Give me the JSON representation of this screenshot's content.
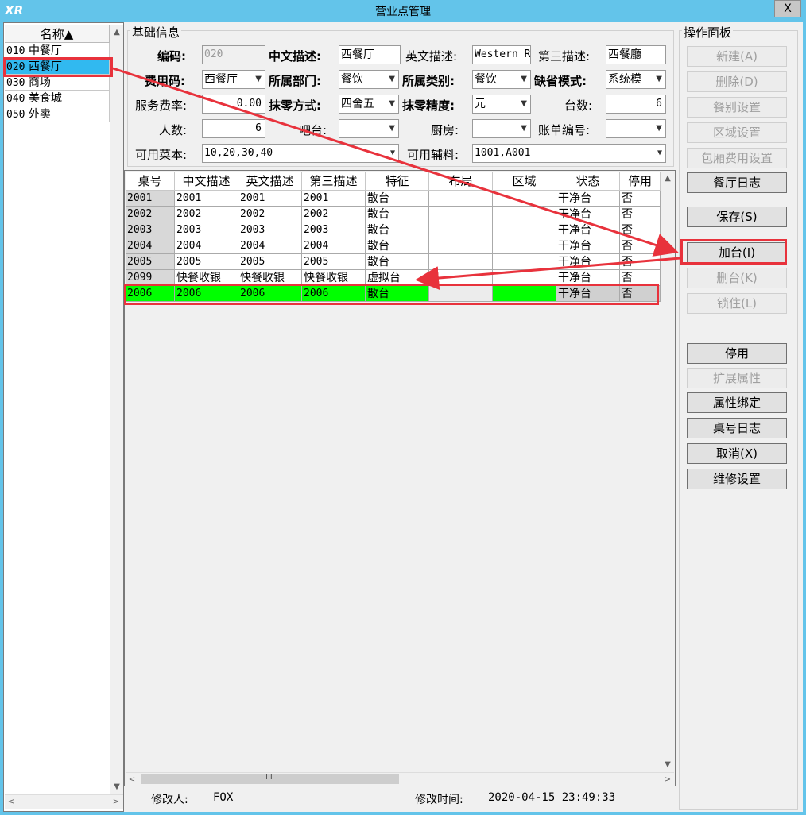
{
  "window": {
    "title": "营业点管理",
    "icon": "XR",
    "close_glyph": "X"
  },
  "left_list": {
    "header": "名称▲",
    "items": [
      {
        "code": "010",
        "name": "中餐厅"
      },
      {
        "code": "020",
        "name": "西餐厅"
      },
      {
        "code": "030",
        "name": "商场"
      },
      {
        "code": "040",
        "name": "美食城"
      },
      {
        "code": "050",
        "name": "外卖"
      }
    ],
    "selected_index": 1
  },
  "basic_info": {
    "legend": "基础信息",
    "code_label": "编码:",
    "code_value": "020",
    "cn_desc_label": "中文描述:",
    "cn_desc_value": "西餐厅",
    "en_desc_label": "英文描述:",
    "en_desc_value": "Western R",
    "third_desc_label": "第三描述:",
    "third_desc_value": "西餐廳",
    "fee_code_label": "费用码:",
    "fee_code_value": "西餐厅",
    "dept_label": "所属部门:",
    "dept_value": "餐饮",
    "category_label": "所属类别:",
    "category_value": "餐饮",
    "default_mode_label": "缺省模式:",
    "default_mode_value": "系统模",
    "service_rate_label": "服务费率:",
    "service_rate_value": "0.00",
    "rounding_method_label": "抹零方式:",
    "rounding_method_value": "四舍五",
    "rounding_precision_label": "抹零精度:",
    "rounding_precision_value": "元",
    "table_count_label": "台数:",
    "table_count_value": "6",
    "people_label": "人数:",
    "people_value": "6",
    "bar_label": "吧台:",
    "bar_value": "",
    "kitchen_label": "厨房:",
    "kitchen_value": "",
    "bill_no_label": "账单编号:",
    "bill_no_value": "",
    "menus_label": "可用菜本:",
    "menus_value": "10,20,30,40",
    "aux_label": "可用辅料:",
    "aux_value": "1001,A001"
  },
  "grid": {
    "columns": [
      "桌号",
      "中文描述",
      "英文描述",
      "第三描述",
      "特征",
      "布局",
      "区域",
      "状态",
      "停用"
    ],
    "rows": [
      [
        "2001",
        "2001",
        "2001",
        "2001",
        "散台",
        "",
        "",
        "干净台",
        "否"
      ],
      [
        "2002",
        "2002",
        "2002",
        "2002",
        "散台",
        "",
        "",
        "干净台",
        "否"
      ],
      [
        "2003",
        "2003",
        "2003",
        "2003",
        "散台",
        "",
        "",
        "干净台",
        "否"
      ],
      [
        "2004",
        "2004",
        "2004",
        "2004",
        "散台",
        "",
        "",
        "干净台",
        "否"
      ],
      [
        "2005",
        "2005",
        "2005",
        "2005",
        "散台",
        "",
        "",
        "干净台",
        "否"
      ],
      [
        "2099",
        "快餐收银",
        "快餐收银",
        "快餐收银",
        "虚拟台",
        "",
        "",
        "干净台",
        "否"
      ],
      [
        "2006",
        "2006",
        "2006",
        "2006",
        "散台",
        "",
        "",
        "干净台",
        "否"
      ]
    ],
    "highlight_row": 6,
    "scroll_grip": "III"
  },
  "footer": {
    "modifier_label": "修改人:",
    "modifier_value": "FOX",
    "time_label": "修改时间:",
    "time_value": "2020-04-15 23:49:33"
  },
  "ops": {
    "legend": "操作面板",
    "buttons": [
      {
        "key": "new",
        "label": "新建(A)",
        "enabled": false
      },
      {
        "key": "delete",
        "label": "删除(D)",
        "enabled": false
      },
      {
        "key": "meal-setting",
        "label": "餐别设置",
        "enabled": false
      },
      {
        "key": "area-setting",
        "label": "区域设置",
        "enabled": false
      },
      {
        "key": "room-fee-setting",
        "label": "包厢费用设置",
        "enabled": false
      },
      {
        "key": "restaurant-log",
        "label": "餐厅日志",
        "enabled": true
      },
      {
        "key": "save",
        "label": "保存(S)",
        "enabled": true
      },
      {
        "key": "add-table",
        "label": "加台(I)",
        "enabled": true
      },
      {
        "key": "delete-table",
        "label": "删台(K)",
        "enabled": false
      },
      {
        "key": "lock",
        "label": "锁住(L)",
        "enabled": false
      },
      {
        "key": "disable",
        "label": "停用",
        "enabled": true
      },
      {
        "key": "extend-attr",
        "label": "扩展属性",
        "enabled": false
      },
      {
        "key": "attr-bind",
        "label": "属性绑定",
        "enabled": true
      },
      {
        "key": "table-log",
        "label": "桌号日志",
        "enabled": true
      },
      {
        "key": "cancel",
        "label": "取消(X)",
        "enabled": true
      },
      {
        "key": "repair-setting",
        "label": "维修设置",
        "enabled": true
      }
    ]
  },
  "colors": {
    "accent": "#63c4ea",
    "selection": "#31b9f0",
    "new_row": "#00ff00",
    "annotation": "#e8323c"
  }
}
